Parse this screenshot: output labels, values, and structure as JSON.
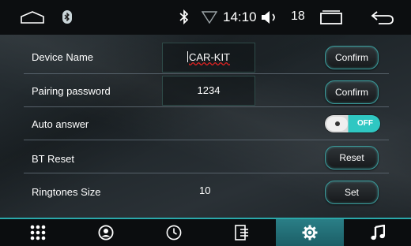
{
  "status_bar": {
    "time": "14:10",
    "volume_level": "18",
    "icons": [
      "home-icon",
      "bluetooth-badge-icon",
      "bluetooth-icon",
      "signal-icon",
      "volume-icon",
      "recent-apps-icon",
      "back-icon"
    ]
  },
  "settings": {
    "device_name": {
      "label": "Device Name",
      "value": "CAR-KIT",
      "button": "Confirm"
    },
    "pairing_password": {
      "label": "Pairing password",
      "value": "1234",
      "button": "Confirm"
    },
    "auto_answer": {
      "label": "Auto answer",
      "toggle_text": "OFF",
      "enabled": false
    },
    "bt_reset": {
      "label": "BT Reset",
      "button": "Reset"
    },
    "ringtones_size": {
      "label": "Ringtones Size",
      "value": "10",
      "button": "Set"
    }
  },
  "bottom_nav": {
    "tabs": [
      "apps-grid-icon",
      "contacts-icon",
      "call-history-icon",
      "dialpad-icon",
      "settings-icon",
      "music-icon"
    ],
    "active": "settings-icon"
  },
  "colors": {
    "accent": "#2fc7c2",
    "active_tab": "#2a7e86",
    "button_border": "#3a9b9b",
    "spellcheck_underline": "#dd2222"
  }
}
